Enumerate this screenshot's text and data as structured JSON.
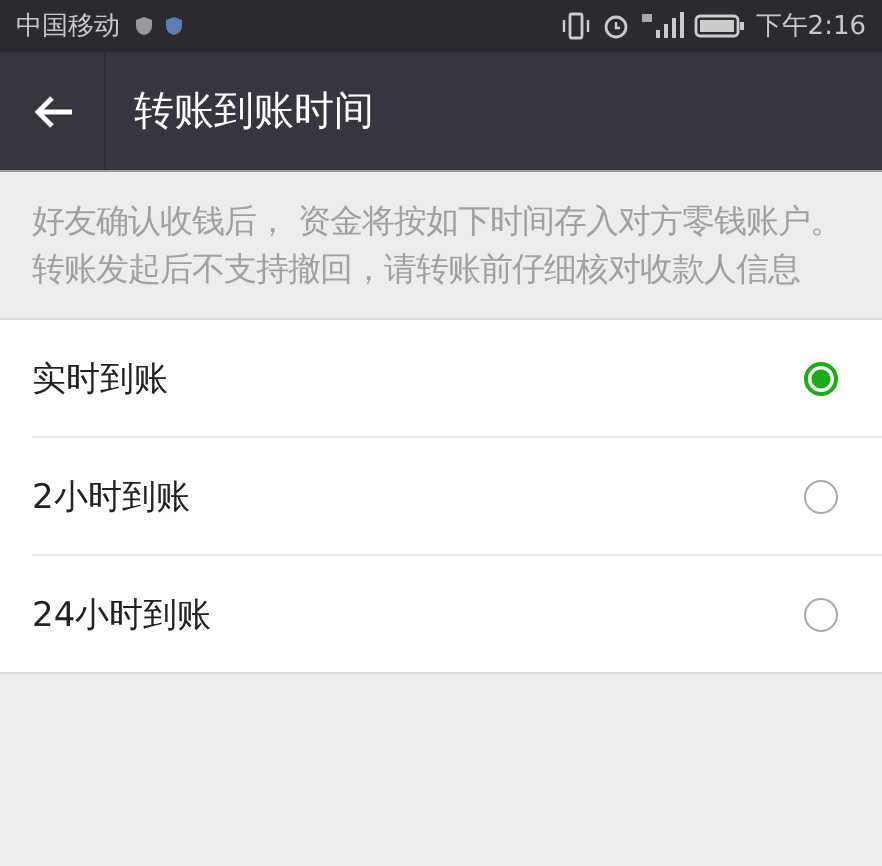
{
  "status_bar": {
    "carrier": "中国移动",
    "time": "下午2:16"
  },
  "app_bar": {
    "title": "转账到账时间"
  },
  "description": "好友确认收钱后， 资金将按如下时间存入对方零钱账户。转账发起后不支持撤回，请转账前仔细核对收款人信息",
  "options": [
    {
      "label": "实时到账",
      "selected": true
    },
    {
      "label": "2小时到账",
      "selected": false
    },
    {
      "label": "24小时到账",
      "selected": false
    }
  ]
}
